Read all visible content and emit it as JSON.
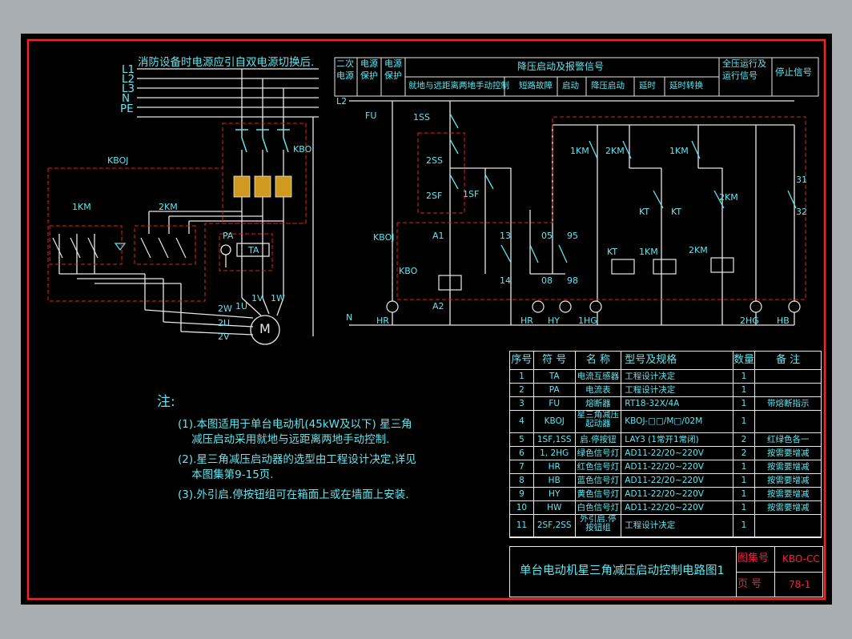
{
  "colors": {
    "border": "#ff2020",
    "wire": "#e8e8e8",
    "text": "#5fe8f0",
    "dashed": "#e02020",
    "background": "#000000",
    "frame": "#a9aeb3"
  },
  "power": {
    "lines": [
      "L1",
      "L2",
      "L3",
      "N",
      "PE"
    ],
    "note": "消防设备时电源应引自双电源切换后.",
    "l2_label": "L2",
    "n_label": "N",
    "fuse": "FU"
  },
  "labels": {
    "kboj_left": "KBOJ",
    "kbo_top": "KBO",
    "km1": "1KM",
    "km2": "2KM",
    "pa": "PA",
    "ta": "TA",
    "u1": "1U",
    "v1": "1V",
    "w1": "1W",
    "w2": "2W",
    "u2": "2U",
    "v2": "2V",
    "motor": "M"
  },
  "header": {
    "c1": "二次\n电源",
    "c2": "电源\n保护",
    "c3": "电源\n保护",
    "c4_top": "降压启动及报警信号",
    "c4a": "就地与远距离两地手动控制",
    "c4b": "短路故障",
    "c4c": "启动",
    "c4d": "降压启动",
    "c4e": "延时",
    "c4f": "延时转换",
    "c5": "全压运行及\n运行信号",
    "c6": "停止信号"
  },
  "control": {
    "ss1": "1SS",
    "ss2": "2SS",
    "sf2": "2SF",
    "sf1": "1SF",
    "kboj": "KBOJ",
    "kbo": "KBO",
    "a1": "A1",
    "a2": "A2",
    "n13": "13",
    "n14": "14",
    "n05": "05",
    "n95": "95",
    "n08": "08",
    "n98": "98",
    "km1a": "1KM",
    "km2a": "2KM",
    "km1b": "1KM",
    "kt1": "KT",
    "kt2": "KT",
    "km2b": "2KM",
    "n31": "31",
    "n32": "32",
    "kt_coil": "KT",
    "km1_coil": "1KM",
    "km2_coil": "2KM",
    "hr": "HR",
    "hr2": "HR",
    "hy": "HY",
    "hg1": "1HG",
    "hg2": "2HG",
    "hb": "HB"
  },
  "notes": {
    "title": "注:",
    "lines": [
      "(1).本图适用于单台电动机(45kW及以下) 星三角",
      "    减压启动采用就地与远距离两地手动控制.",
      "(2).星三角减压启动器的选型由工程设计决定,详见",
      "    本图集第9-15页.",
      "(3).外引启.停按钮组可在箱面上或在墙面上安装."
    ]
  },
  "table": {
    "headers": [
      "序号",
      "符 号",
      "名 称",
      "型号及规格",
      "数量",
      "备 注"
    ],
    "rows": [
      [
        "1",
        "TA",
        "电流互感器",
        "工程设计决定",
        "1",
        ""
      ],
      [
        "2",
        "PA",
        "电流表",
        "工程设计决定",
        "1",
        ""
      ],
      [
        "3",
        "FU",
        "熔断器",
        "RT18-32X/4A",
        "1",
        "带熔断指示"
      ],
      [
        "4",
        "KBOJ",
        "星三角减压\n起动器",
        "KBOJ-□□/M□/02M",
        "1",
        ""
      ],
      [
        "5",
        "1SF,1SS",
        "启.停按钮",
        "LAY3 (1常开1常闭)",
        "2",
        "红绿色各一"
      ],
      [
        "6",
        "1, 2HG",
        "绿色信号灯",
        "AD11-22/20~220V",
        "2",
        "按需要增减"
      ],
      [
        "7",
        "HR",
        "红色信号灯",
        "AD11-22/20~220V",
        "1",
        "按需要增减"
      ],
      [
        "8",
        "HB",
        "蓝色信号灯",
        "AD11-22/20~220V",
        "1",
        "按需要增减"
      ],
      [
        "9",
        "HY",
        "黄色信号灯",
        "AD11-22/20~220V",
        "1",
        "按需要增减"
      ],
      [
        "10",
        "HW",
        "白色信号灯",
        "AD11-22/20~220V",
        "1",
        "按需要增减"
      ],
      [
        "11",
        "2SF,2SS",
        "外引启.停\n按钮组",
        "工程设计决定",
        "1",
        ""
      ]
    ]
  },
  "title_block": {
    "title": "单台电动机星三角减压启动控制电路图1",
    "atlas_label": "图集号",
    "atlas_no": "KBO-CC",
    "page_label": "页 号",
    "page_no": "78-1"
  }
}
